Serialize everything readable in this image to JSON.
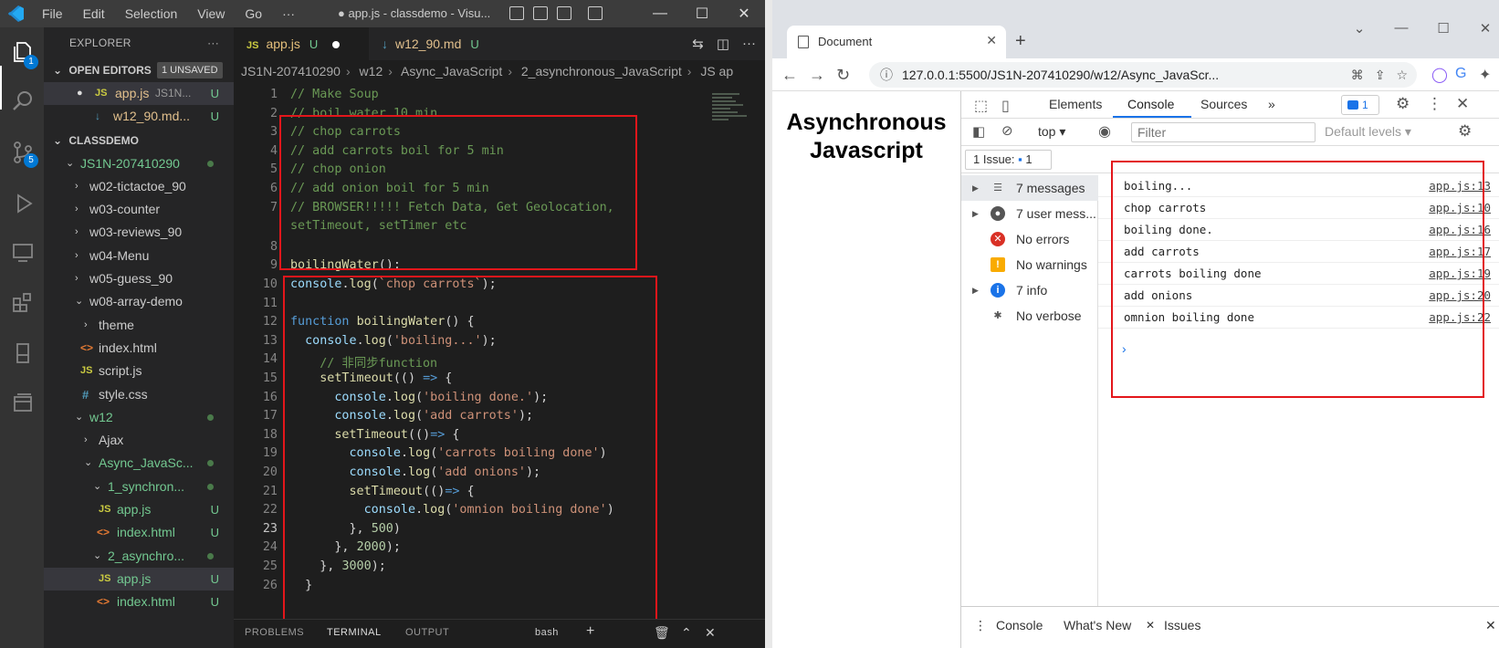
{
  "vscode": {
    "menu": [
      "File",
      "Edit",
      "Selection",
      "View",
      "Go",
      "···"
    ],
    "window_title": "● app.js - classdemo - Visu...",
    "controls": {
      "minimize": "—",
      "maximize": "☐",
      "close": "✕"
    },
    "activity": {
      "explorer_badge": "1",
      "scm_badge": "5"
    },
    "sidebar": {
      "header": "EXPLORER",
      "open_editors": {
        "title": "OPEN EDITORS",
        "unsaved": "1 UNSAVED",
        "items": [
          {
            "icon": "JS",
            "name": "app.js",
            "detail": "JS1N...",
            "status": "U"
          },
          {
            "icon": "↓",
            "name": "w12_90.md...",
            "status": "U"
          }
        ]
      },
      "workspace": "CLASSDEMO",
      "tree": [
        {
          "label": "JS1N-207410290",
          "status": "dot"
        },
        {
          "label": "w02-tictactoe_90"
        },
        {
          "label": "w03-counter"
        },
        {
          "label": "w03-reviews_90"
        },
        {
          "label": "w04-Menu"
        },
        {
          "label": "w05-guess_90"
        },
        {
          "label": "w08-array-demo"
        },
        {
          "label": "theme"
        },
        {
          "label": "index.html",
          "icon": "<>"
        },
        {
          "label": "script.js",
          "icon": "JS"
        },
        {
          "label": "style.css",
          "icon": "#"
        },
        {
          "label": "w12",
          "status": "dot"
        },
        {
          "label": "Ajax"
        },
        {
          "label": "Async_JavaSc...",
          "status": "dot"
        },
        {
          "label": "1_synchron...",
          "status": "dot"
        },
        {
          "label": "app.js",
          "icon": "JS",
          "status": "U"
        },
        {
          "label": "index.html",
          "icon": "<>",
          "status": "U"
        },
        {
          "label": "2_asynchro...",
          "status": "dot"
        },
        {
          "label": "app.js",
          "icon": "JS",
          "status": "U"
        },
        {
          "label": "index.html",
          "icon": "<>",
          "status": "U"
        }
      ]
    },
    "tabs": [
      {
        "icon": "JS",
        "name": "app.js",
        "status": "U"
      },
      {
        "icon": "↓",
        "name": "w12_90.md",
        "status": "U"
      }
    ],
    "breadcrumb": [
      "JS1N-207410290",
      "w12",
      "Async_JavaScript",
      "2_asynchronous_JavaScript",
      "JS ap"
    ],
    "code_lines": [
      {
        "n": "1",
        "text": "// Make Soup"
      },
      {
        "n": "2",
        "text": "// boil water 10 min"
      },
      {
        "n": "3",
        "text": "// chop carrots"
      },
      {
        "n": "4",
        "text": "// add carrots boil for 5 min"
      },
      {
        "n": "5",
        "text": "// chop onion"
      },
      {
        "n": "6",
        "text": "// add onion boil for 5 min"
      },
      {
        "n": "7",
        "text": "// BROWSER!!!!! Fetch Data, Get Geolocation,"
      },
      {
        "n": "",
        "text": "setTimeout, setTimer etc"
      },
      {
        "n": "8",
        "text": ""
      },
      {
        "n": "9",
        "text": "boilingWater();"
      },
      {
        "n": "10",
        "text": "console.log(`chop carrots`);"
      },
      {
        "n": "11",
        "text": ""
      },
      {
        "n": "12",
        "text": "function boilingWater() {"
      },
      {
        "n": "13",
        "text": "  console.log('boiling...');"
      },
      {
        "n": "14",
        "text": "    // 非同步function"
      },
      {
        "n": "15",
        "text": "    setTimeout(() => {"
      },
      {
        "n": "16",
        "text": "      console.log('boiling done.');"
      },
      {
        "n": "17",
        "text": "      console.log('add carrots');"
      },
      {
        "n": "18",
        "text": "      setTimeout(()=> {"
      },
      {
        "n": "19",
        "text": "        console.log('carrots boiling done')"
      },
      {
        "n": "20",
        "text": "        console.log('add onions');"
      },
      {
        "n": "21",
        "text": "        setTimeout(()=> {"
      },
      {
        "n": "22",
        "text": "          console.log('omnion boiling done')"
      },
      {
        "n": "23",
        "text": "        }, 500)"
      },
      {
        "n": "24",
        "text": "      }, 2000);"
      },
      {
        "n": "25",
        "text": "    }, 3000);"
      },
      {
        "n": "26",
        "text": "  }"
      }
    ],
    "panel_tabs": [
      "PROBLEMS",
      "TERMINAL",
      "OUTPUT",
      "bash"
    ]
  },
  "chrome": {
    "tab_title": "Document",
    "url": "127.0.0.1:5500/JS1N-207410290/w12/Async_JavaScr...",
    "page_heading_1": "Asynchronous",
    "page_heading_2": "Javascript",
    "devtools": {
      "tabs": [
        "Elements",
        "Console",
        "Sources",
        "»"
      ],
      "issues_badge": "1",
      "context": "top",
      "filter_placeholder": "Filter",
      "levels": "Default levels",
      "issue_button": "1 Issue:",
      "issue_count": "1",
      "sidebar": [
        {
          "label": "7 messages",
          "icon": "list"
        },
        {
          "label": "7 user mess...",
          "icon": "user"
        },
        {
          "label": "No errors",
          "icon": "error"
        },
        {
          "label": "No warnings",
          "icon": "warning"
        },
        {
          "label": "7 info",
          "icon": "info"
        },
        {
          "label": "No verbose",
          "icon": "bug"
        }
      ],
      "messages": [
        {
          "text": "boiling...",
          "source": "app.js:13"
        },
        {
          "text": "chop carrots",
          "source": "app.js:10"
        },
        {
          "text": "boiling done.",
          "source": "app.js:16"
        },
        {
          "text": "add carrots",
          "source": "app.js:17"
        },
        {
          "text": "carrots boiling done",
          "source": "app.js:19"
        },
        {
          "text": "add onions",
          "source": "app.js:20"
        },
        {
          "text": "omnion boiling done",
          "source": "app.js:22"
        }
      ],
      "drawer_tabs": [
        "Console",
        "What's New",
        "Issues"
      ]
    }
  },
  "colors": {
    "highlight_box": "#e3161b",
    "vscode_bg": "#1e1e1e",
    "accent": "#1a73e8"
  }
}
